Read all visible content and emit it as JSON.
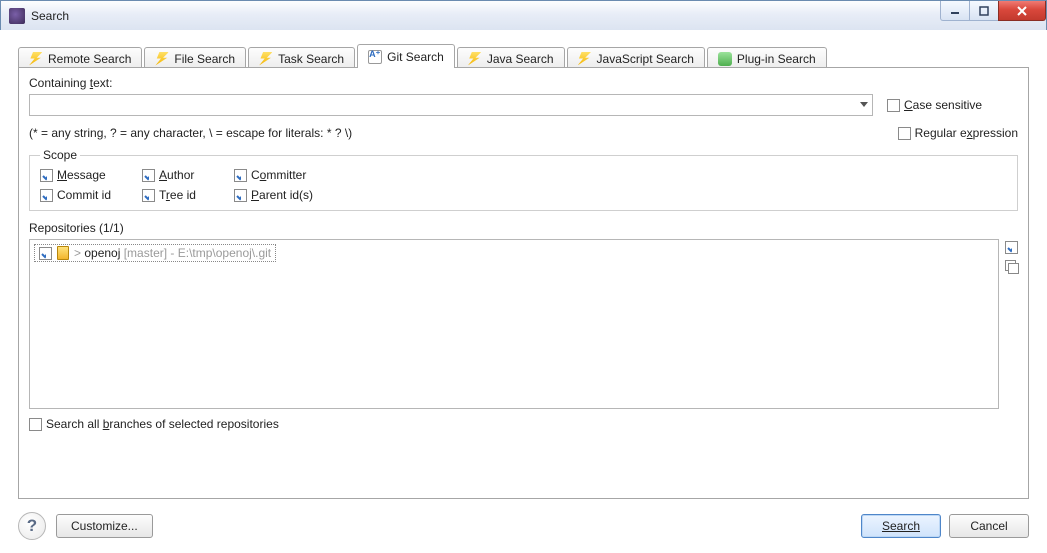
{
  "window": {
    "title": "Search"
  },
  "tabs": [
    {
      "label": "Remote Search"
    },
    {
      "label": "File Search"
    },
    {
      "label": "Task Search"
    },
    {
      "label": "Git Search"
    },
    {
      "label": "Java Search"
    },
    {
      "label": "JavaScript Search"
    },
    {
      "label": "Plug-in Search"
    }
  ],
  "containing_text": {
    "label_pre": "Containing ",
    "label_mn": "t",
    "label_post": "ext:",
    "value": ""
  },
  "hint": "(* = any string, ? = any character, \\ = escape for literals: * ? \\)",
  "case_sensitive": {
    "pre": "",
    "mn": "C",
    "post": "ase sensitive",
    "checked": false
  },
  "regex": {
    "pre": "Regular e",
    "mn": "x",
    "post": "pression",
    "checked": false
  },
  "scope": {
    "legend": "Scope",
    "items": [
      {
        "pre": "",
        "mn": "M",
        "post": "essage",
        "checked": true
      },
      {
        "pre": "",
        "mn": "A",
        "post": "uthor",
        "checked": true
      },
      {
        "pre": "C",
        "mn": "o",
        "post": "mmitter",
        "checked": true
      },
      {
        "pre": "Commit id",
        "mn": "",
        "post": "",
        "checked": true
      },
      {
        "pre": "T",
        "mn": "r",
        "post": "ee id",
        "checked": true
      },
      {
        "pre": "",
        "mn": "P",
        "post": "arent id(s)",
        "checked": true
      }
    ]
  },
  "repositories": {
    "label": "Repositories (1/1)",
    "items": [
      {
        "checked": true,
        "prefix": "> ",
        "name": "openoj",
        "branch": " [master]",
        "path": " - E:\\tmp\\openoj\\.git"
      }
    ],
    "select_all_checked": true
  },
  "search_all_branches": {
    "pre": "Search all ",
    "mn": "b",
    "post": "ranches of selected repositories",
    "checked": false
  },
  "footer": {
    "customize": "Customize...",
    "search": "Search",
    "cancel": "Cancel"
  }
}
